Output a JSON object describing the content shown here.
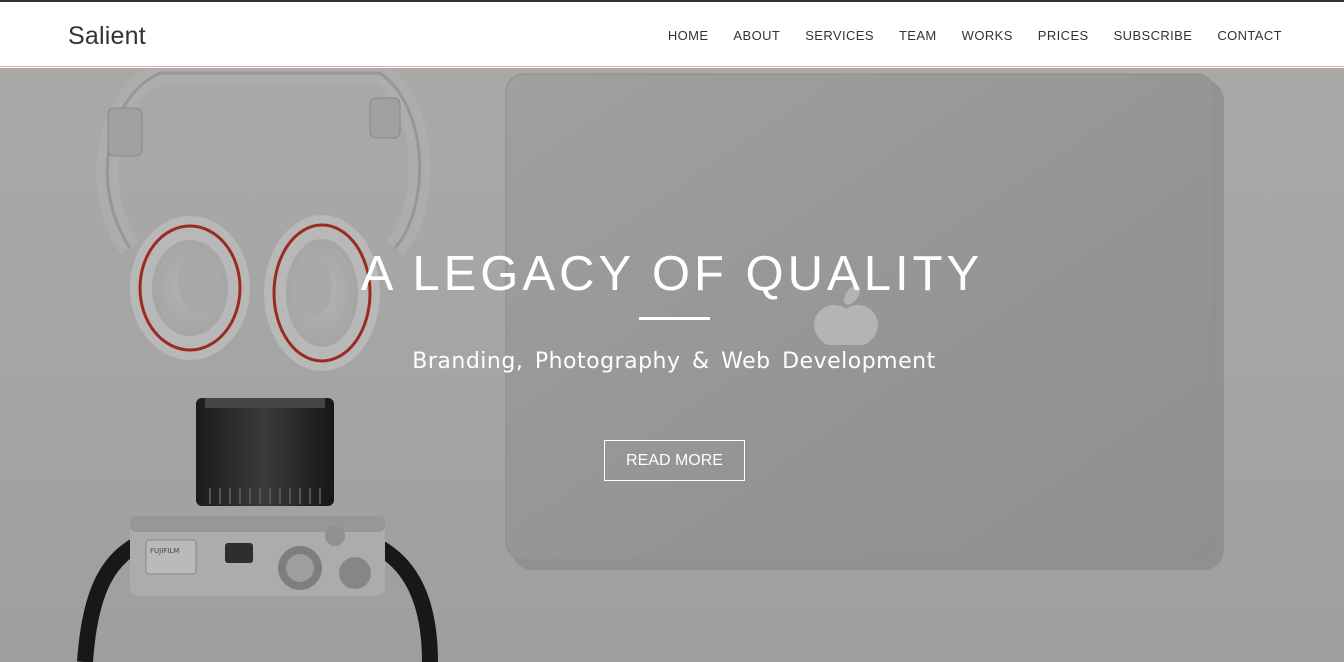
{
  "brand": "Salient",
  "nav": [
    "HOME",
    "ABOUT",
    "SERVICES",
    "TEAM",
    "WORKS",
    "PRICES",
    "SUBSCRIBE",
    "CONTACT"
  ],
  "hero": {
    "title": "A LEGACY OF QUALITY",
    "subtitle": "Branding, Photography & Web Development",
    "button": "READ MORE",
    "camera_brand": "FUJIFILM"
  },
  "colors": {
    "accent_line": "#e8a9a0",
    "text_dark": "#333333",
    "hero_text": "#ffffff"
  }
}
